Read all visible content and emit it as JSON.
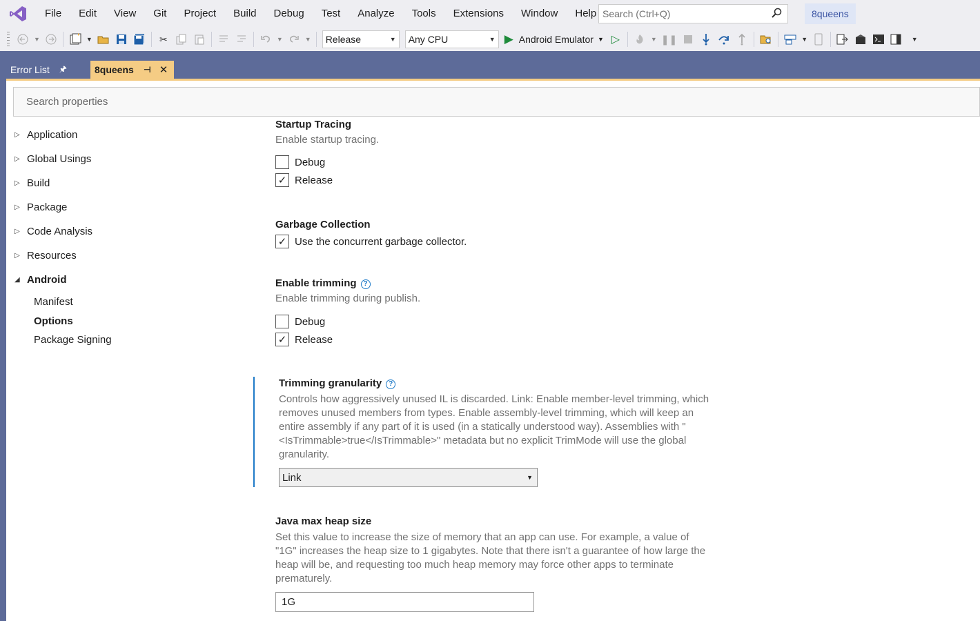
{
  "menubar": {
    "items": [
      "File",
      "Edit",
      "View",
      "Git",
      "Project",
      "Build",
      "Debug",
      "Test",
      "Analyze",
      "Tools",
      "Extensions",
      "Window",
      "Help"
    ],
    "search_placeholder": "Search (Ctrl+Q)",
    "project_name": "8queens"
  },
  "toolbar": {
    "configuration": "Release",
    "platform": "Any CPU",
    "run_target": "Android Emulator"
  },
  "tabs": {
    "error_list": "Error List",
    "active": "8queens"
  },
  "properties": {
    "search_placeholder": "Search properties",
    "nav": {
      "application": "Application",
      "global_usings": "Global Usings",
      "build": "Build",
      "package": "Package",
      "code_analysis": "Code Analysis",
      "resources": "Resources",
      "android": "Android",
      "manifest": "Manifest",
      "options": "Options",
      "package_signing": "Package Signing"
    },
    "startup_tracing": {
      "title": "Startup Tracing",
      "desc": "Enable startup tracing.",
      "debug_label": "Debug",
      "debug_checked": false,
      "release_label": "Release",
      "release_checked": true
    },
    "garbage_collection": {
      "title": "Garbage Collection",
      "concurrent_label": "Use the concurrent garbage collector.",
      "concurrent_checked": true
    },
    "trimming": {
      "title": "Enable trimming",
      "desc": "Enable trimming during publish.",
      "debug_label": "Debug",
      "debug_checked": false,
      "release_label": "Release",
      "release_checked": true
    },
    "trimming_granularity": {
      "title": "Trimming granularity",
      "desc": "Controls how aggressively unused IL is discarded. Link: Enable member-level trimming, which removes unused members from types. Enable assembly-level trimming, which will keep an entire assembly if any part of it is used (in a statically understood way). Assemblies with \"<IsTrimmable>true</IsTrimmable>\" metadata but no explicit TrimMode will use the global granularity.",
      "value": "Link"
    },
    "java_heap": {
      "title": "Java max heap size",
      "desc": "Set this value to increase the size of memory that an app can use. For example, a value of \"1G\" increases the heap size to 1 gigabytes. Note that there isn't a guarantee of how large the heap will be, and requesting too much heap memory may force other apps to terminate prematurely.",
      "value": "1G"
    }
  },
  "colors": {
    "accent": "#1e7ac8",
    "tab_active": "#f5cc84",
    "chrome": "#5d6b99",
    "run_green": "#1e8a3a"
  }
}
